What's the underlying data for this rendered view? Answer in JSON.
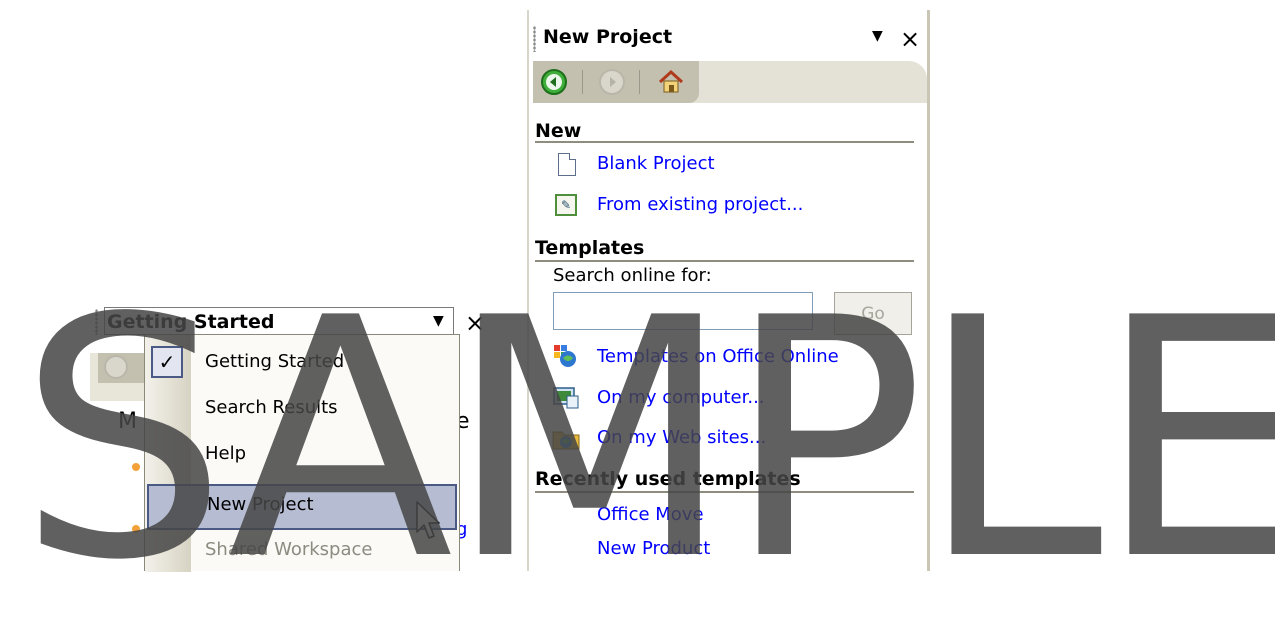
{
  "new_project_pane": {
    "title": "New Project",
    "dropdown_glyph": "▼",
    "close_glyph": "×",
    "nav": {
      "back_icon": "back-arrow-icon",
      "forward_icon": "forward-arrow-icon",
      "home_icon": "home-icon"
    },
    "sections": {
      "new": {
        "heading": "New",
        "items": [
          {
            "label": "Blank Project",
            "icon": "blank-document-icon"
          },
          {
            "label": "From existing project...",
            "icon": "existing-project-icon"
          }
        ]
      },
      "templates": {
        "heading": "Templates",
        "search_label": "Search online for:",
        "search_value": "",
        "go_label": "Go",
        "items": [
          {
            "label": "Templates on Office Online",
            "icon": "office-online-icon"
          },
          {
            "label": "On my computer...",
            "icon": "my-computer-icon"
          },
          {
            "label": "On my Web sites...",
            "icon": "web-sites-icon"
          }
        ]
      },
      "recent": {
        "heading": "Recently used templates",
        "items": [
          {
            "label": "Office Move"
          },
          {
            "label": "New Product"
          }
        ]
      }
    }
  },
  "getting_started_pane": {
    "title": "Getting Started",
    "dropdown_glyph": "▼",
    "close_glyph": "×",
    "partial_text_left": "M",
    "partial_text_right": "e",
    "partial_text_link": "g",
    "menu": {
      "items": [
        {
          "label": "Getting Started",
          "checked": true,
          "enabled": true
        },
        {
          "label": "Search Results",
          "checked": false,
          "enabled": true
        },
        {
          "label": "Help",
          "checked": false,
          "enabled": true
        },
        {
          "label": "New Project",
          "checked": false,
          "enabled": true,
          "highlighted": true
        },
        {
          "label": "Shared Workspace",
          "checked": false,
          "enabled": false
        }
      ],
      "check_glyph": "✓"
    }
  },
  "watermark": "SAMPLE",
  "colors": {
    "link": "#0000ff",
    "menu_highlight": "#b6bdd2",
    "menu_border": "#4b5a85",
    "nav_bar": "#c4c0b0"
  }
}
